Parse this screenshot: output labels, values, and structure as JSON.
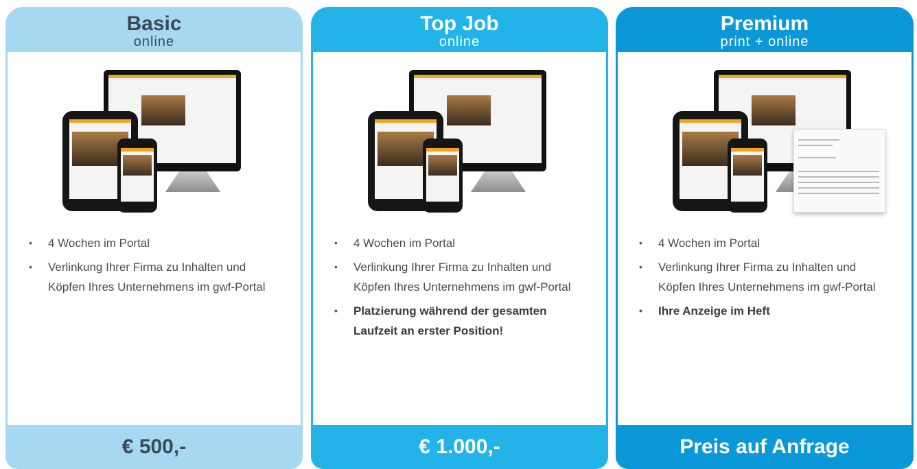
{
  "plans": [
    {
      "title": "Basic",
      "subtitle": "online",
      "features": [
        "4 Wochen im Portal",
        "Verlinkung Ihrer Firma zu Inhalten und Köpfen Ihres Unternehmens im gwf-Portal"
      ],
      "price": "€ 500,-"
    },
    {
      "title": "Top Job",
      "subtitle": "online",
      "features": [
        "4 Wochen im Portal",
        "Verlinkung Ihrer Firma zu Inhalten und Köpfen Ihres Unternehmens im gwf-Portal",
        "Platzierung während der gesamten Laufzeit an erster Position!"
      ],
      "price": "€ 1.000,-"
    },
    {
      "title": "Premium",
      "subtitle": "print + online",
      "features": [
        "4 Wochen im Portal",
        "Verlinkung Ihrer Firma zu Inhalten und Köpfen Ihres Unternehmens im gwf-Portal",
        "Ihre Anzeige im Heft"
      ],
      "price": "Preis auf Anfrage"
    }
  ],
  "colors": {
    "basic": "#a6d9f1",
    "topjob": "#22b4e8",
    "premium": "#0b98d8",
    "accent": "#f3a51c"
  },
  "icons": {
    "bullet": "bullet-icon",
    "devices": "devices-mockup-image",
    "magazine": "magazine-image"
  }
}
